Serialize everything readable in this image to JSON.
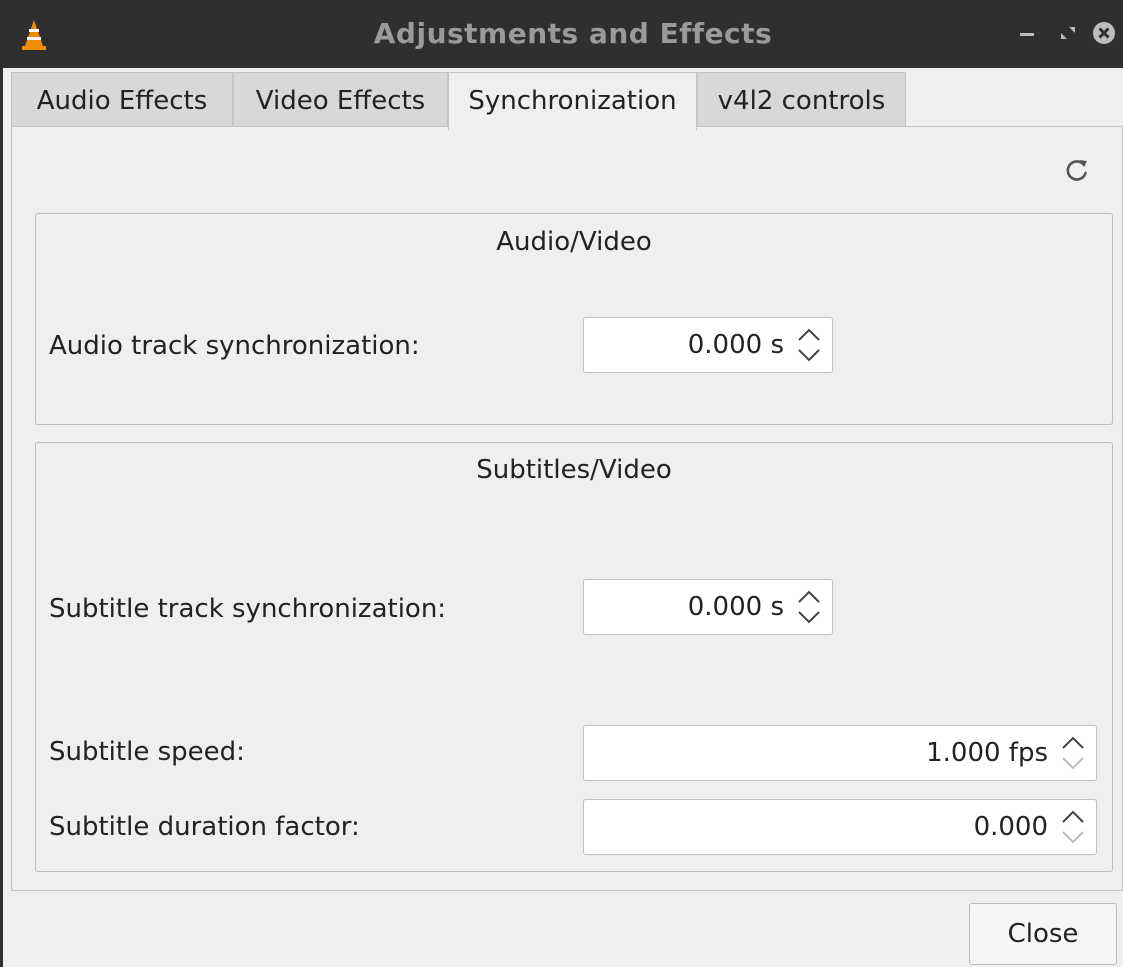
{
  "window": {
    "title": "Adjustments and Effects",
    "icons": {
      "app": "vlc-cone-icon",
      "minimize": "minimize-icon",
      "maximize": "maximize-icon",
      "close": "close-icon"
    }
  },
  "tabs": [
    {
      "label": "Audio Effects",
      "active": false
    },
    {
      "label": "Video Effects",
      "active": false
    },
    {
      "label": "Synchronization",
      "active": true
    },
    {
      "label": "v4l2 controls",
      "active": false
    }
  ],
  "toolbar": {
    "reset_icon": "refresh-icon"
  },
  "audio_video": {
    "title": "Audio/Video",
    "audio_sync_label": "Audio track synchronization:",
    "audio_sync_value": "0.000 s"
  },
  "subtitles_video": {
    "title": "Subtitles/Video",
    "subtitle_sync_label": "Subtitle track synchronization:",
    "subtitle_sync_value": "0.000 s",
    "subtitle_speed_label": "Subtitle speed:",
    "subtitle_speed_value": "1.000 fps",
    "subtitle_duration_label": "Subtitle duration factor:",
    "subtitle_duration_value": "0.000"
  },
  "footer": {
    "close_label": "Close"
  },
  "colors": {
    "titlebar_bg": "#2f2f2f",
    "window_bg": "#efefef",
    "vlc_orange": "#f08c00"
  }
}
